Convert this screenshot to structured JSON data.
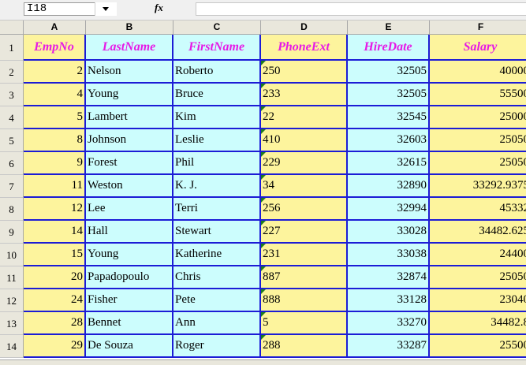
{
  "formula_bar": {
    "cell_ref": "I18",
    "fx_label": "fx",
    "formula": ""
  },
  "columns": [
    "A",
    "B",
    "C",
    "D",
    "E",
    "F"
  ],
  "headers": [
    "EmpNo",
    "LastName",
    "FirstName",
    "PhoneExt",
    "HireDate",
    "Salary"
  ],
  "rows": [
    {
      "num": "1"
    },
    {
      "num": "2",
      "EmpNo": "2",
      "LastName": "Nelson",
      "FirstName": "Roberto",
      "PhoneExt": "250",
      "HireDate": "32505",
      "Salary": "40000"
    },
    {
      "num": "3",
      "EmpNo": "4",
      "LastName": "Young",
      "FirstName": "Bruce",
      "PhoneExt": "233",
      "HireDate": "32505",
      "Salary": "55500"
    },
    {
      "num": "4",
      "EmpNo": "5",
      "LastName": "Lambert",
      "FirstName": "Kim",
      "PhoneExt": "22",
      "HireDate": "32545",
      "Salary": "25000"
    },
    {
      "num": "5",
      "EmpNo": "8",
      "LastName": "Johnson",
      "FirstName": "Leslie",
      "PhoneExt": "410",
      "HireDate": "32603",
      "Salary": "25050"
    },
    {
      "num": "6",
      "EmpNo": "9",
      "LastName": "Forest",
      "FirstName": "Phil",
      "PhoneExt": "229",
      "HireDate": "32615",
      "Salary": "25050"
    },
    {
      "num": "7",
      "EmpNo": "11",
      "LastName": "Weston",
      "FirstName": "K. J.",
      "PhoneExt": "34",
      "HireDate": "32890",
      "Salary": "33292.9375"
    },
    {
      "num": "8",
      "EmpNo": "12",
      "LastName": "Lee",
      "FirstName": "Terri",
      "PhoneExt": "256",
      "HireDate": "32994",
      "Salary": "45332"
    },
    {
      "num": "9",
      "EmpNo": "14",
      "LastName": "Hall",
      "FirstName": "Stewart",
      "PhoneExt": "227",
      "HireDate": "33028",
      "Salary": "34482.625"
    },
    {
      "num": "10",
      "EmpNo": "15",
      "LastName": "Young",
      "FirstName": "Katherine",
      "PhoneExt": "231",
      "HireDate": "33038",
      "Salary": "24400"
    },
    {
      "num": "11",
      "EmpNo": "20",
      "LastName": "Papadopoulo",
      "FirstName": "Chris",
      "PhoneExt": "887",
      "HireDate": "32874",
      "Salary": "25050"
    },
    {
      "num": "12",
      "EmpNo": "24",
      "LastName": "Fisher",
      "FirstName": "Pete",
      "PhoneExt": "888",
      "HireDate": "33128",
      "Salary": "23040"
    },
    {
      "num": "13",
      "EmpNo": "28",
      "LastName": "Bennet",
      "FirstName": "Ann",
      "PhoneExt": "5",
      "HireDate": "33270",
      "Salary": "34482.8"
    },
    {
      "num": "14",
      "EmpNo": "29",
      "LastName": "De Souza",
      "FirstName": "Roger",
      "PhoneExt": "288",
      "HireDate": "33287",
      "Salary": "25500"
    }
  ],
  "colors": {
    "yellow_fill": "#fdf49d",
    "cyan_fill": "#ccfdfd",
    "grid_border": "#1c1cd6",
    "header_text": "#e619e6",
    "text_marker": "#1f7a1f"
  }
}
